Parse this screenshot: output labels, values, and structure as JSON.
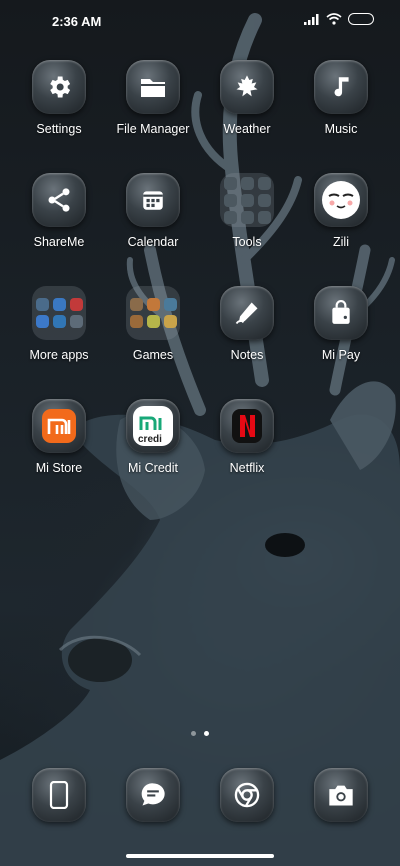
{
  "status_bar": {
    "time": "2:36 AM"
  },
  "apps": [
    {
      "label": "Settings",
      "icon": "gear-icon"
    },
    {
      "label": "File Manager",
      "icon": "folder-icon"
    },
    {
      "label": "Weather",
      "icon": "maple-leaf-icon"
    },
    {
      "label": "Music",
      "icon": "music-note-icon"
    },
    {
      "label": "ShareMe",
      "icon": "share-icon"
    },
    {
      "label": "Calendar",
      "icon": "calendar-icon"
    },
    {
      "label": "Tools",
      "icon": "tools-folder-icon"
    },
    {
      "label": "Zili",
      "icon": "zili-face-icon"
    },
    {
      "label": "More apps",
      "icon": "more-apps-folder-icon"
    },
    {
      "label": "Games",
      "icon": "games-folder-icon"
    },
    {
      "label": "Notes",
      "icon": "pen-icon"
    },
    {
      "label": "Mi Pay",
      "icon": "shopping-bag-icon"
    },
    {
      "label": "Mi Store",
      "icon": "mi-logo-icon"
    },
    {
      "label": "Mi Credit",
      "icon": "mi-credit-icon"
    },
    {
      "label": "Netflix",
      "icon": "netflix-icon"
    }
  ],
  "dock": [
    {
      "name": "phone",
      "icon": "phone-icon"
    },
    {
      "name": "messages",
      "icon": "message-icon"
    },
    {
      "name": "chrome",
      "icon": "chrome-icon"
    },
    {
      "name": "camera",
      "icon": "camera-icon"
    }
  ],
  "page_indicator": {
    "pages": 2,
    "active": 2
  },
  "colors": {
    "mi_orange": "#f26a1b",
    "netflix_red": "#e50914",
    "icon_glass": "#3a4248"
  }
}
